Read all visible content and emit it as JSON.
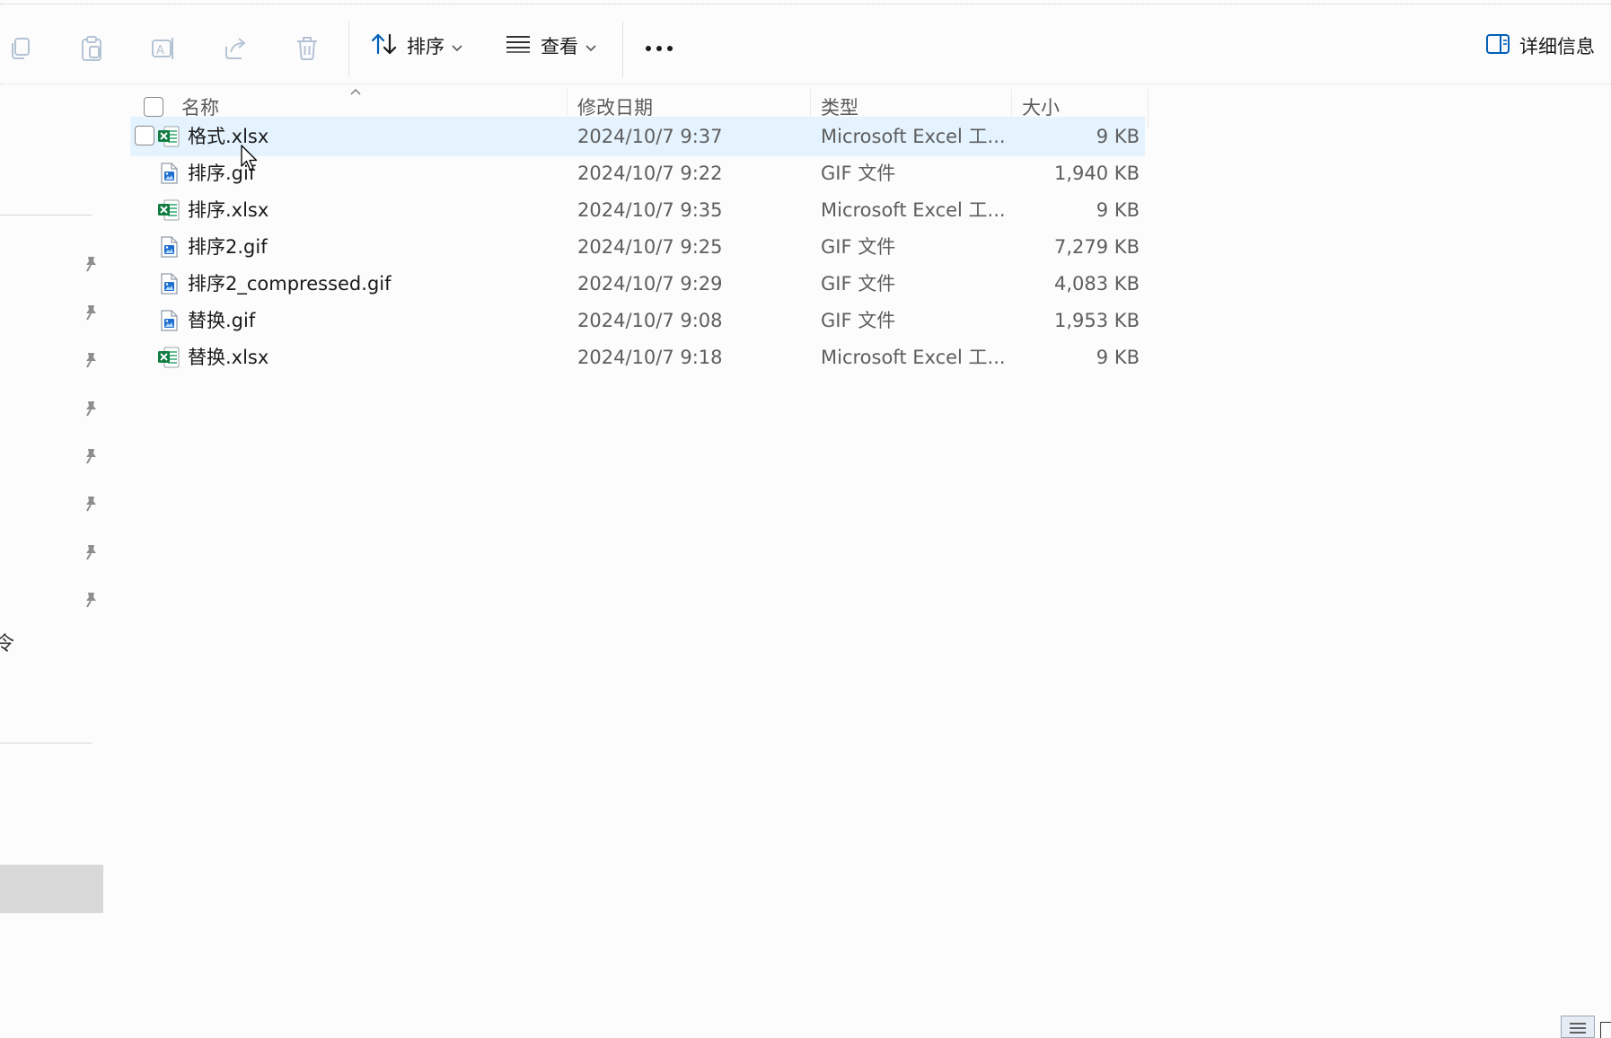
{
  "toolbar": {
    "sort_label": "排序",
    "view_label": "查看",
    "details_label": "详细信息"
  },
  "columns": {
    "name": "名称",
    "date": "修改日期",
    "type": "类型",
    "size": "大小"
  },
  "files": [
    {
      "name": "格式.xlsx",
      "date": "2024/10/7 9:37",
      "type": "Microsoft Excel 工...",
      "size": "9 KB",
      "icon": "excel-file-icon"
    },
    {
      "name": "排序.gif",
      "date": "2024/10/7 9:22",
      "type": "GIF 文件",
      "size": "1,940 KB",
      "icon": "gif-file-icon"
    },
    {
      "name": "排序.xlsx",
      "date": "2024/10/7 9:35",
      "type": "Microsoft Excel 工...",
      "size": "9 KB",
      "icon": "excel-file-icon"
    },
    {
      "name": "排序2.gif",
      "date": "2024/10/7 9:25",
      "type": "GIF 文件",
      "size": "7,279 KB",
      "icon": "gif-file-icon"
    },
    {
      "name": "排序2_compressed.gif",
      "date": "2024/10/7 9:29",
      "type": "GIF 文件",
      "size": "4,083 KB",
      "icon": "gif-file-icon"
    },
    {
      "name": "替换.gif",
      "date": "2024/10/7 9:08",
      "type": "GIF 文件",
      "size": "1,953 KB",
      "icon": "gif-file-icon"
    },
    {
      "name": "替换.xlsx",
      "date": "2024/10/7 9:18",
      "type": "Microsoft Excel 工...",
      "size": "9 KB",
      "icon": "excel-file-icon"
    }
  ],
  "sidebar": {
    "clipped_text": "令"
  },
  "colors": {
    "accent": "#005fb8",
    "selected_row": "#e5f3ff",
    "excel_green": "#107c41",
    "disabled_icon": "#b4c3d3"
  }
}
